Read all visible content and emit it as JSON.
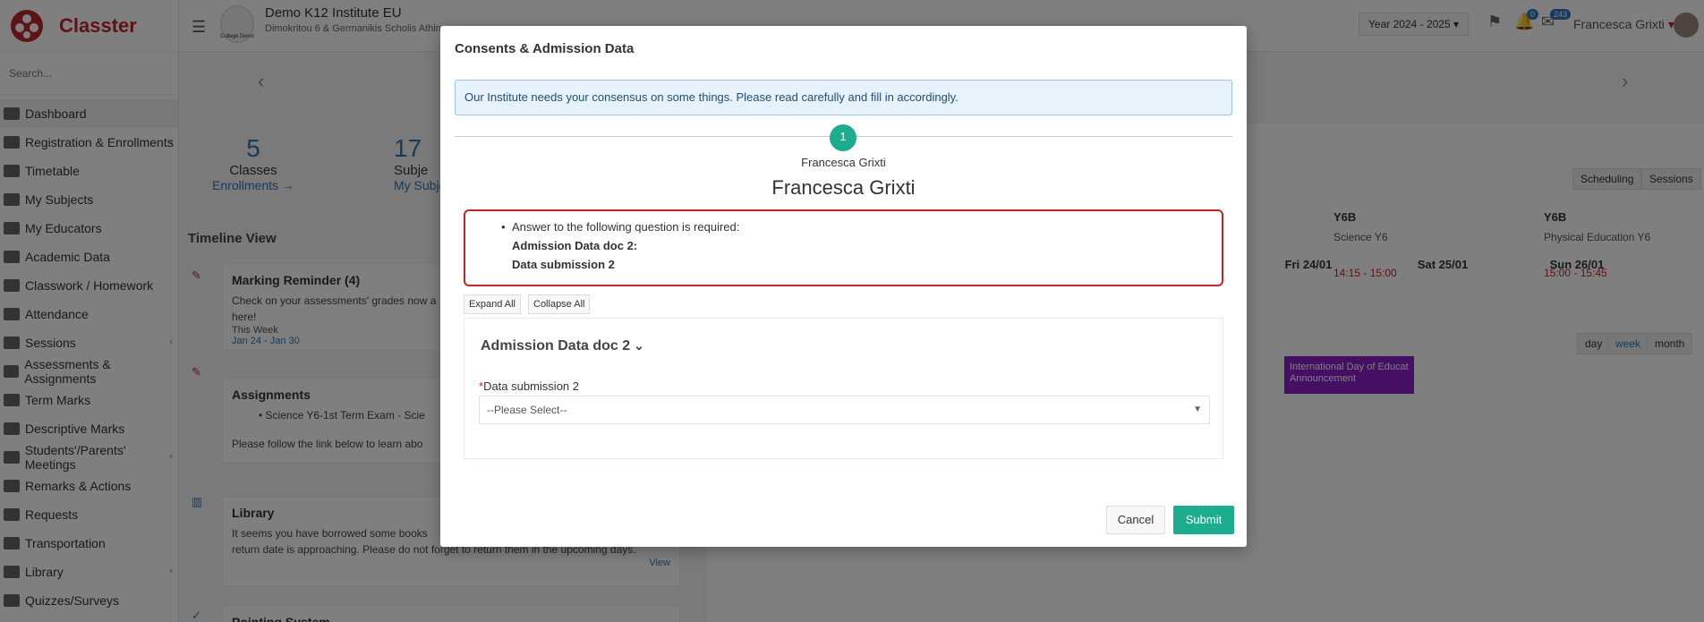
{
  "app": {
    "name": "Classter"
  },
  "sidebar": {
    "search_placeholder": "Search...",
    "items": [
      {
        "label": "Dashboard",
        "icon": "monitor-icon"
      },
      {
        "label": "Registration & Enrollments",
        "icon": "bank-icon"
      },
      {
        "label": "Timetable",
        "icon": "calendar-icon"
      },
      {
        "label": "My Subjects",
        "icon": "book-icon"
      },
      {
        "label": "My Educators",
        "icon": "users-icon"
      },
      {
        "label": "Academic Data",
        "icon": "graduation-icon"
      },
      {
        "label": "Classwork / Homework",
        "icon": "list-icon"
      },
      {
        "label": "Attendance",
        "icon": "user-check-icon"
      },
      {
        "label": "Sessions",
        "icon": "video-icon"
      },
      {
        "label": "Assessments & Assignments",
        "icon": "edit-icon"
      },
      {
        "label": "Term Marks",
        "icon": "note-icon"
      },
      {
        "label": "Descriptive Marks",
        "icon": "chart-icon"
      },
      {
        "label": "Students'/Parents' Meetings",
        "icon": "meeting-icon"
      },
      {
        "label": "Remarks & Actions",
        "icon": "remark-icon"
      },
      {
        "label": "Requests",
        "icon": "request-icon"
      },
      {
        "label": "Transportation",
        "icon": "bus-icon"
      },
      {
        "label": "Library",
        "icon": "library-icon"
      },
      {
        "label": "Quizzes/Surveys",
        "icon": "quiz-icon"
      }
    ]
  },
  "header": {
    "institute_name": "Demo K12 Institute EU",
    "institute_address": "Dimokritou 6 & Germanikis Scholis Athin",
    "logo_text": "College Demo",
    "year": "Year 2024 - 2025",
    "notif_count": "0",
    "messages_count": "243",
    "user_name": "Francesca Grixti"
  },
  "dashboard": {
    "stats": [
      {
        "num": "5",
        "label": "Classes",
        "link": "Enrollments →"
      },
      {
        "num": "17",
        "label": "Subje",
        "link": "My Subje"
      }
    ],
    "timeline_title": "Timeline View",
    "cards": [
      {
        "title": "Marking Reminder (4)",
        "text": "Check on your assessments' grades now a",
        "text2": "here!",
        "small": "This Week",
        "link": "Jan 24 - Jan 30"
      },
      {
        "title": "Assignments",
        "bullet": "Science Y6-1st Term Exam - Scie",
        "text": "Please follow the link below to learn abo"
      },
      {
        "title": "Library",
        "text": "It seems you have borrowed some books",
        "text2": "return date is approaching. Please do not forget to return them in the upcoming days.",
        "link": "View"
      },
      {
        "title": "Pointing System"
      }
    ],
    "calendar": {
      "top_buttons": [
        "Scheduling",
        "Sessions"
      ],
      "view_buttons": [
        "day",
        "week",
        "month"
      ],
      "events": [
        {
          "cls": "Y6B",
          "subject": "Science Y6",
          "time": "14:15 - 15:00"
        },
        {
          "cls": "Y6B",
          "subject": "Physical Education Y6",
          "time": "15:00 - 15:45"
        }
      ],
      "days": [
        "Fri 24/01",
        "Sat 25/01",
        "Sun 26/01"
      ],
      "announcement": "International Day of Educat Announcement"
    }
  },
  "modal": {
    "title": "Consents & Admission Data",
    "info": "Our Institute needs your consensus on some things. Please read carefully and fill in accordingly.",
    "step_number": "1",
    "step_name_small": "Francesca Grixti",
    "step_name_big": "Francesca Grixti",
    "error": {
      "message": "Answer to the following question is required:",
      "doc": "Admission Data doc 2:",
      "field": "Data submission 2"
    },
    "expand_label": "Expand All",
    "collapse_label": "Collapse All",
    "doc_title": "Admission Data doc 2",
    "field_label": "Data submission 2",
    "select_value": "--Please Select--",
    "cancel_label": "Cancel",
    "submit_label": "Submit"
  },
  "colors": {
    "brand": "#c0262d",
    "accent": "#1cac8e",
    "link": "#2a76bb"
  }
}
